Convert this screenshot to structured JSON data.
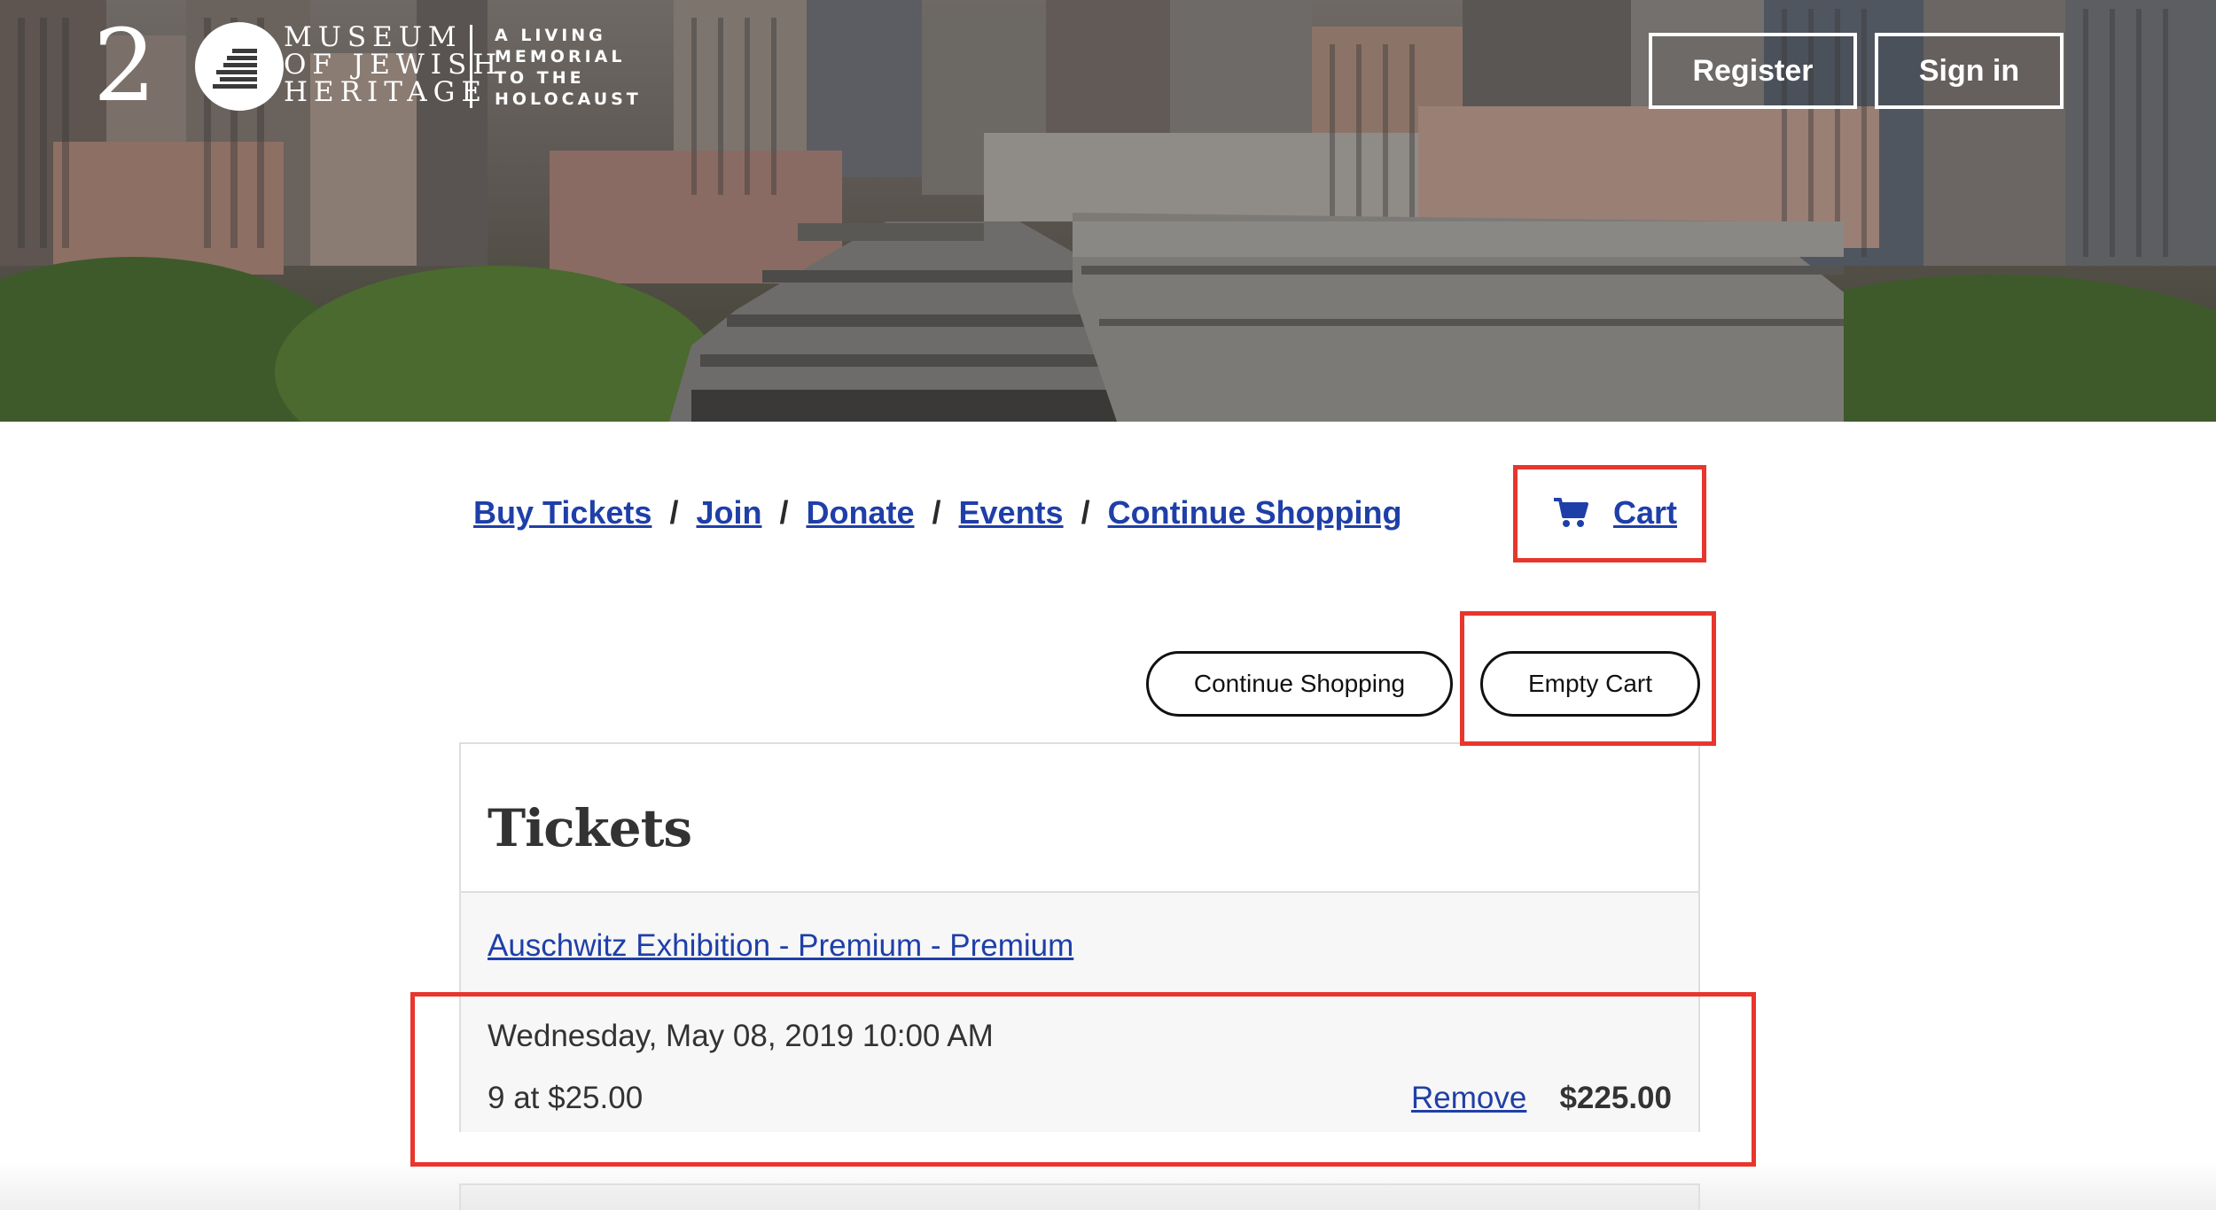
{
  "header": {
    "logo": {
      "number": "2",
      "line1": "MUSEUM",
      "line2": "OF JEWISH",
      "line3": "HERITAGE",
      "tagline1": "A LIVING",
      "tagline2": "MEMORIAL",
      "tagline3": "TO THE",
      "tagline4": "HOLOCAUST"
    },
    "register_label": "Register",
    "signin_label": "Sign in"
  },
  "nav": {
    "items": [
      {
        "label": "Buy Tickets"
      },
      {
        "label": "Join"
      },
      {
        "label": "Donate"
      },
      {
        "label": "Events"
      },
      {
        "label": "Continue Shopping"
      }
    ],
    "separator": "/",
    "cart_label": "Cart",
    "cart_icon": "cart-icon"
  },
  "actions": {
    "continue_shopping_label": "Continue Shopping",
    "empty_cart_label": "Empty Cart"
  },
  "tickets": {
    "title": "Tickets",
    "product_name": "Auschwitz Exhibition - Premium - Premium",
    "line": {
      "datetime": "Wednesday, May 08, 2019 10:00 AM",
      "quantity_price": "9 at $25.00",
      "remove_label": "Remove",
      "total": "$225.00"
    }
  },
  "colors": {
    "link": "#1f3fa8",
    "highlight": "#e8362d",
    "text": "#333333"
  }
}
